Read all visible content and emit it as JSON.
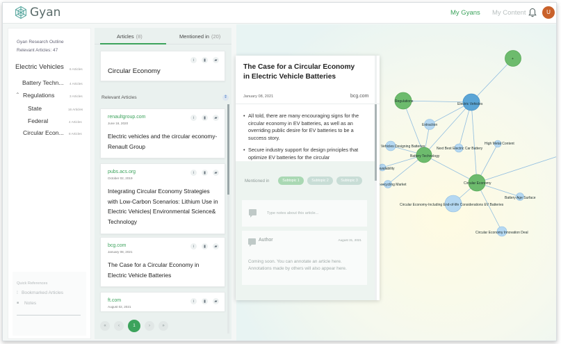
{
  "header": {
    "brand": "Gyan",
    "nav": {
      "my_gyans": "My Gyans",
      "my_content": "My Content"
    },
    "avatar_initial": "U",
    "colors": {
      "accent": "#3ca35c",
      "avatar": "#c9612a"
    }
  },
  "outline": {
    "title": "Gyan Research Outline",
    "relevant": "Relevant Articles: 47",
    "items": [
      {
        "label": "Electric Vehicles",
        "count": "6 Articles"
      },
      {
        "label": "Battery Techn...",
        "count": "4 Articles"
      },
      {
        "label": "Regulations",
        "count": "3 Articles"
      },
      {
        "label": "State",
        "count": "16 Articles"
      },
      {
        "label": "Federal",
        "count": "4 Articles"
      },
      {
        "label": "Circular Econ...",
        "count": "8 Articles"
      }
    ],
    "quick_refs": {
      "title": "Quick References",
      "bookmarked": "Bookmarked Articles",
      "notes": "Notes"
    }
  },
  "articles": {
    "tabs": [
      {
        "label": "Articles",
        "count": "(8)"
      },
      {
        "label": "Mentioned in",
        "count": "(20)"
      }
    ],
    "topic_title": "Circular Economy",
    "relevant_label": "Relevant Articles",
    "cards": [
      {
        "source": "renaultgroup.com",
        "date": "June 16, 2020",
        "title": "Electric vehicles and the circular economy- Renault Group"
      },
      {
        "source": "pubs.acs.org",
        "date": "October 02, 2019",
        "title": "Integrating Circular Economy Strategies with Low-Carbon Scenarios: Lithium Use in Electric Vehicles| Environmental Science& Technology"
      },
      {
        "source": "bcg.com",
        "date": "January 08, 2021",
        "title": "The Case for a Circular Economy in Electric Vehicle Batteries"
      },
      {
        "source": "ft.com",
        "date": "August 02, 2021",
        "title": ""
      }
    ],
    "pager": {
      "prev2": "«",
      "prev": "‹",
      "page": "1",
      "next": "›",
      "next2": "»"
    }
  },
  "detail": {
    "title": "The Case for a Circular Economy in Electric Vehicle Batteries",
    "date": "January 08, 2021",
    "domain": "bcg.com",
    "bullets": [
      "All told, there are many encouraging signs for the circular economy in EV batteries, as well as an overriding public desire for EV batteries to be a success story.",
      "Secure industry support for design principles that optimize EV batteries for the circular"
    ],
    "mentioned_in": "Mentioned in",
    "subtopics": [
      "Subtopic 1",
      "Subtopic 2",
      "Subtopic 3"
    ],
    "note_placeholder": "Type notes about this article...",
    "author": "Author",
    "author_date": "August 31, 2021",
    "coming_soon": "Coming soon. You can annotate an article here. Annotations made by others will also appear here."
  },
  "graph": {
    "nodes": [
      {
        "id": "top",
        "label": "+"
      },
      {
        "id": "reg",
        "label": "Regulations"
      },
      {
        "id": "ev",
        "label": "Electric Vehicles"
      },
      {
        "id": "extraction",
        "label": "Extraction"
      },
      {
        "id": "design",
        "label": "Vehicles Designing Batteries"
      },
      {
        "id": "battery",
        "label": "Battery Technology"
      },
      {
        "id": "nextbest",
        "label": "Next Best Electric Car Battery"
      },
      {
        "id": "highmetal",
        "label": "High Metal Content"
      },
      {
        "id": "avail",
        "label": "Availability"
      },
      {
        "id": "recycle",
        "label": "y-recycling Market"
      },
      {
        "id": "ce",
        "label": "Circular Economy"
      },
      {
        "id": "agesurface",
        "label": "Battery Age Surface"
      },
      {
        "id": "eol",
        "label": "Circular Economy-Including End-of-life Considerations EV Batteries"
      },
      {
        "id": "innov",
        "label": "Circular Economy Innovation Deal"
      }
    ],
    "colors": {
      "green": "#6dbb6d",
      "blue": "#5ba5d6",
      "light_blue": "#b5d8f2",
      "edge": "#8fbde0"
    }
  }
}
